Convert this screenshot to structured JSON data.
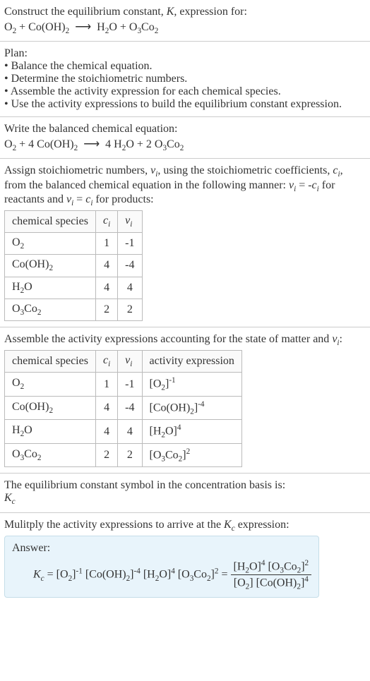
{
  "header": {
    "line1": "Construct the equilibrium constant, ",
    "line1_k": "K",
    "line1_end": ", expression for:",
    "eq_left": "O",
    "eq_left2": " + Co(OH)",
    "eq_right1": "H",
    "eq_right2": "O + O",
    "eq_right3": "Co"
  },
  "plan": {
    "title": "Plan:",
    "item1": "• Balance the chemical equation.",
    "item2": "• Determine the stoichiometric numbers.",
    "item3": "• Assemble the activity expression for each chemical species.",
    "item4": "• Use the activity expressions to build the equilibrium constant expression."
  },
  "balanced": {
    "title": "Write the balanced chemical equation:",
    "left1": "O",
    "left2": " + 4 Co(OH)",
    "right1": "4 H",
    "right2": "O + 2 O",
    "right3": "Co"
  },
  "assign": {
    "text1": "Assign stoichiometric numbers, ",
    "nu": "ν",
    "sub_i": "i",
    "text2": ", using the stoichiometric coefficients, ",
    "c": "c",
    "text3": ", from the balanced chemical equation in the following manner: ",
    "eq1_lhs": " = -",
    "text4": " for reactants and ",
    "eq2_lhs": " = ",
    "text5": " for products:"
  },
  "table1": {
    "h1": "chemical species",
    "h2": "c",
    "h3": "ν",
    "rows": [
      {
        "sp1": "O",
        "sub1": "2",
        "sp2": "",
        "sub2": "",
        "c": "1",
        "v": "-1"
      },
      {
        "sp1": "Co(OH)",
        "sub1": "2",
        "sp2": "",
        "sub2": "",
        "c": "4",
        "v": "-4"
      },
      {
        "sp1": "H",
        "sub1": "2",
        "sp2": "O",
        "sub2": "",
        "c": "4",
        "v": "4"
      },
      {
        "sp1": "O",
        "sub1": "3",
        "sp2": "Co",
        "sub2": "2",
        "c": "2",
        "v": "2"
      }
    ]
  },
  "assemble": {
    "text1": "Assemble the activity expressions accounting for the state of matter and ",
    "nu": "ν",
    "text2": ":"
  },
  "table2": {
    "h1": "chemical species",
    "h2": "c",
    "h3": "ν",
    "h4": "activity expression",
    "rows": [
      {
        "sp1": "O",
        "sub1": "2",
        "sp2": "",
        "sub2": "",
        "c": "1",
        "v": "-1",
        "act1": "[O",
        "asub1": "2",
        "act2": "]",
        "exp": "-1"
      },
      {
        "sp1": "Co(OH)",
        "sub1": "2",
        "sp2": "",
        "sub2": "",
        "c": "4",
        "v": "-4",
        "act1": "[Co(OH)",
        "asub1": "2",
        "act2": "]",
        "exp": "-4"
      },
      {
        "sp1": "H",
        "sub1": "2",
        "sp2": "O",
        "sub2": "",
        "c": "4",
        "v": "4",
        "act1": "[H",
        "asub1": "2",
        "act2": "O]",
        "exp": "4"
      },
      {
        "sp1": "O",
        "sub1": "3",
        "sp2": "Co",
        "sub2": "2",
        "c": "2",
        "v": "2",
        "act1": "[O",
        "asub1": "3",
        "act2": "Co",
        "asub2": "2",
        "act3": "]",
        "exp": "2"
      }
    ]
  },
  "symbol": {
    "text": "The equilibrium constant symbol in the concentration basis is:",
    "k": "K",
    "sub": "c"
  },
  "multiply": {
    "text1": "Mulitply the activity expressions to arrive at the ",
    "k": "K",
    "sub": "c",
    "text2": " expression:"
  },
  "answer": {
    "label": "Answer:",
    "k": "K",
    "ksub": "c",
    "eq": " = ",
    "t1": "[O",
    "t1s": "2",
    "t1e": "]",
    "e1": "-1",
    "t2": " [Co(OH)",
    "t2s": "2",
    "t2e": "]",
    "e2": "-4",
    "t3": " [H",
    "t3s": "2",
    "t3e": "O]",
    "e3": "4",
    "t4": " [O",
    "t4s": "3",
    "t4m": "Co",
    "t4s2": "2",
    "t4e": "]",
    "e4": "2",
    "eq2": " = ",
    "num1": "[H",
    "num1s": "2",
    "num1e": "O]",
    "ne1": "4",
    "num2": " [O",
    "num2s": "3",
    "num2m": "Co",
    "num2s2": "2",
    "num2e": "]",
    "ne2": "2",
    "den1": "[O",
    "den1s": "2",
    "den1e": "]",
    "den2": " [Co(OH)",
    "den2s": "2",
    "den2e": "]",
    "de2": "4"
  },
  "arrow": "⟶",
  "two": "2",
  "three": "3"
}
